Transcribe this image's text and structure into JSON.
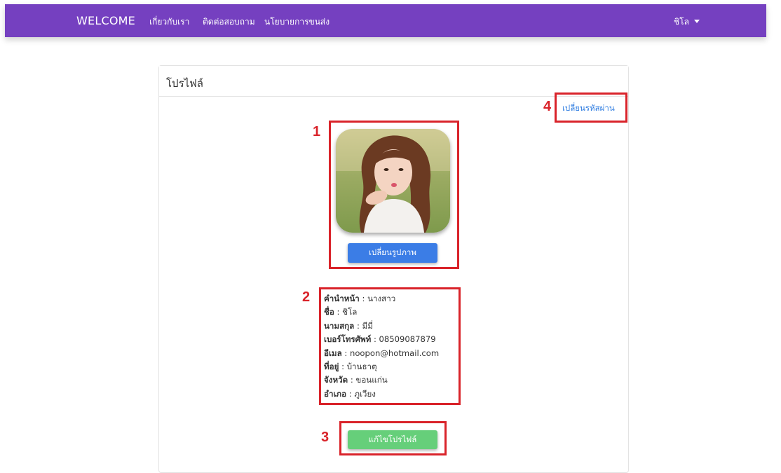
{
  "navbar": {
    "brand": "WELCOME",
    "links": [
      "เกี่ยวกับเรา",
      "ติดต่อสอบถาม",
      "นโยบายการขนส่ง"
    ],
    "user_name": "ชิโล"
  },
  "profile": {
    "title": "โปรไฟล์",
    "change_password_label": "เปลี่ยนรหัสผ่าน",
    "change_photo_label": "เปลี่ยนรูปภาพ",
    "edit_profile_label": "แก้ไขโปรไฟล์",
    "fields": [
      {
        "label": "คำนำหน้า",
        "sep": " : ",
        "value": "นางสาว"
      },
      {
        "label": "ชื่อ",
        "sep": " : ",
        "value": "ชิโล"
      },
      {
        "label": "นามสกุล",
        "sep": " : ",
        "value": "มีมี่"
      },
      {
        "label": "เบอร์โทรศัพท์",
        "sep": " : ",
        "value": "08509087879"
      },
      {
        "label": "อีเมล",
        "sep": " : ",
        "value": "noopon@hotmail.com"
      },
      {
        "label": "ที่อยู่",
        "sep": " : ",
        "value": "บ้านธาตุ"
      },
      {
        "label": "จังหวัด",
        "sep": " : ",
        "value": "ขอนแก่น"
      },
      {
        "label": "อำเภอ",
        "sep": " : ",
        "value": "ภูเวียง"
      }
    ]
  },
  "annotations": [
    "1",
    "2",
    "3",
    "4"
  ],
  "colors": {
    "navbar": "#7540c0",
    "annotation": "#d9232a",
    "primary_button": "#3b7de6",
    "success_button": "#66cf7a",
    "link": "#2f7de1"
  }
}
